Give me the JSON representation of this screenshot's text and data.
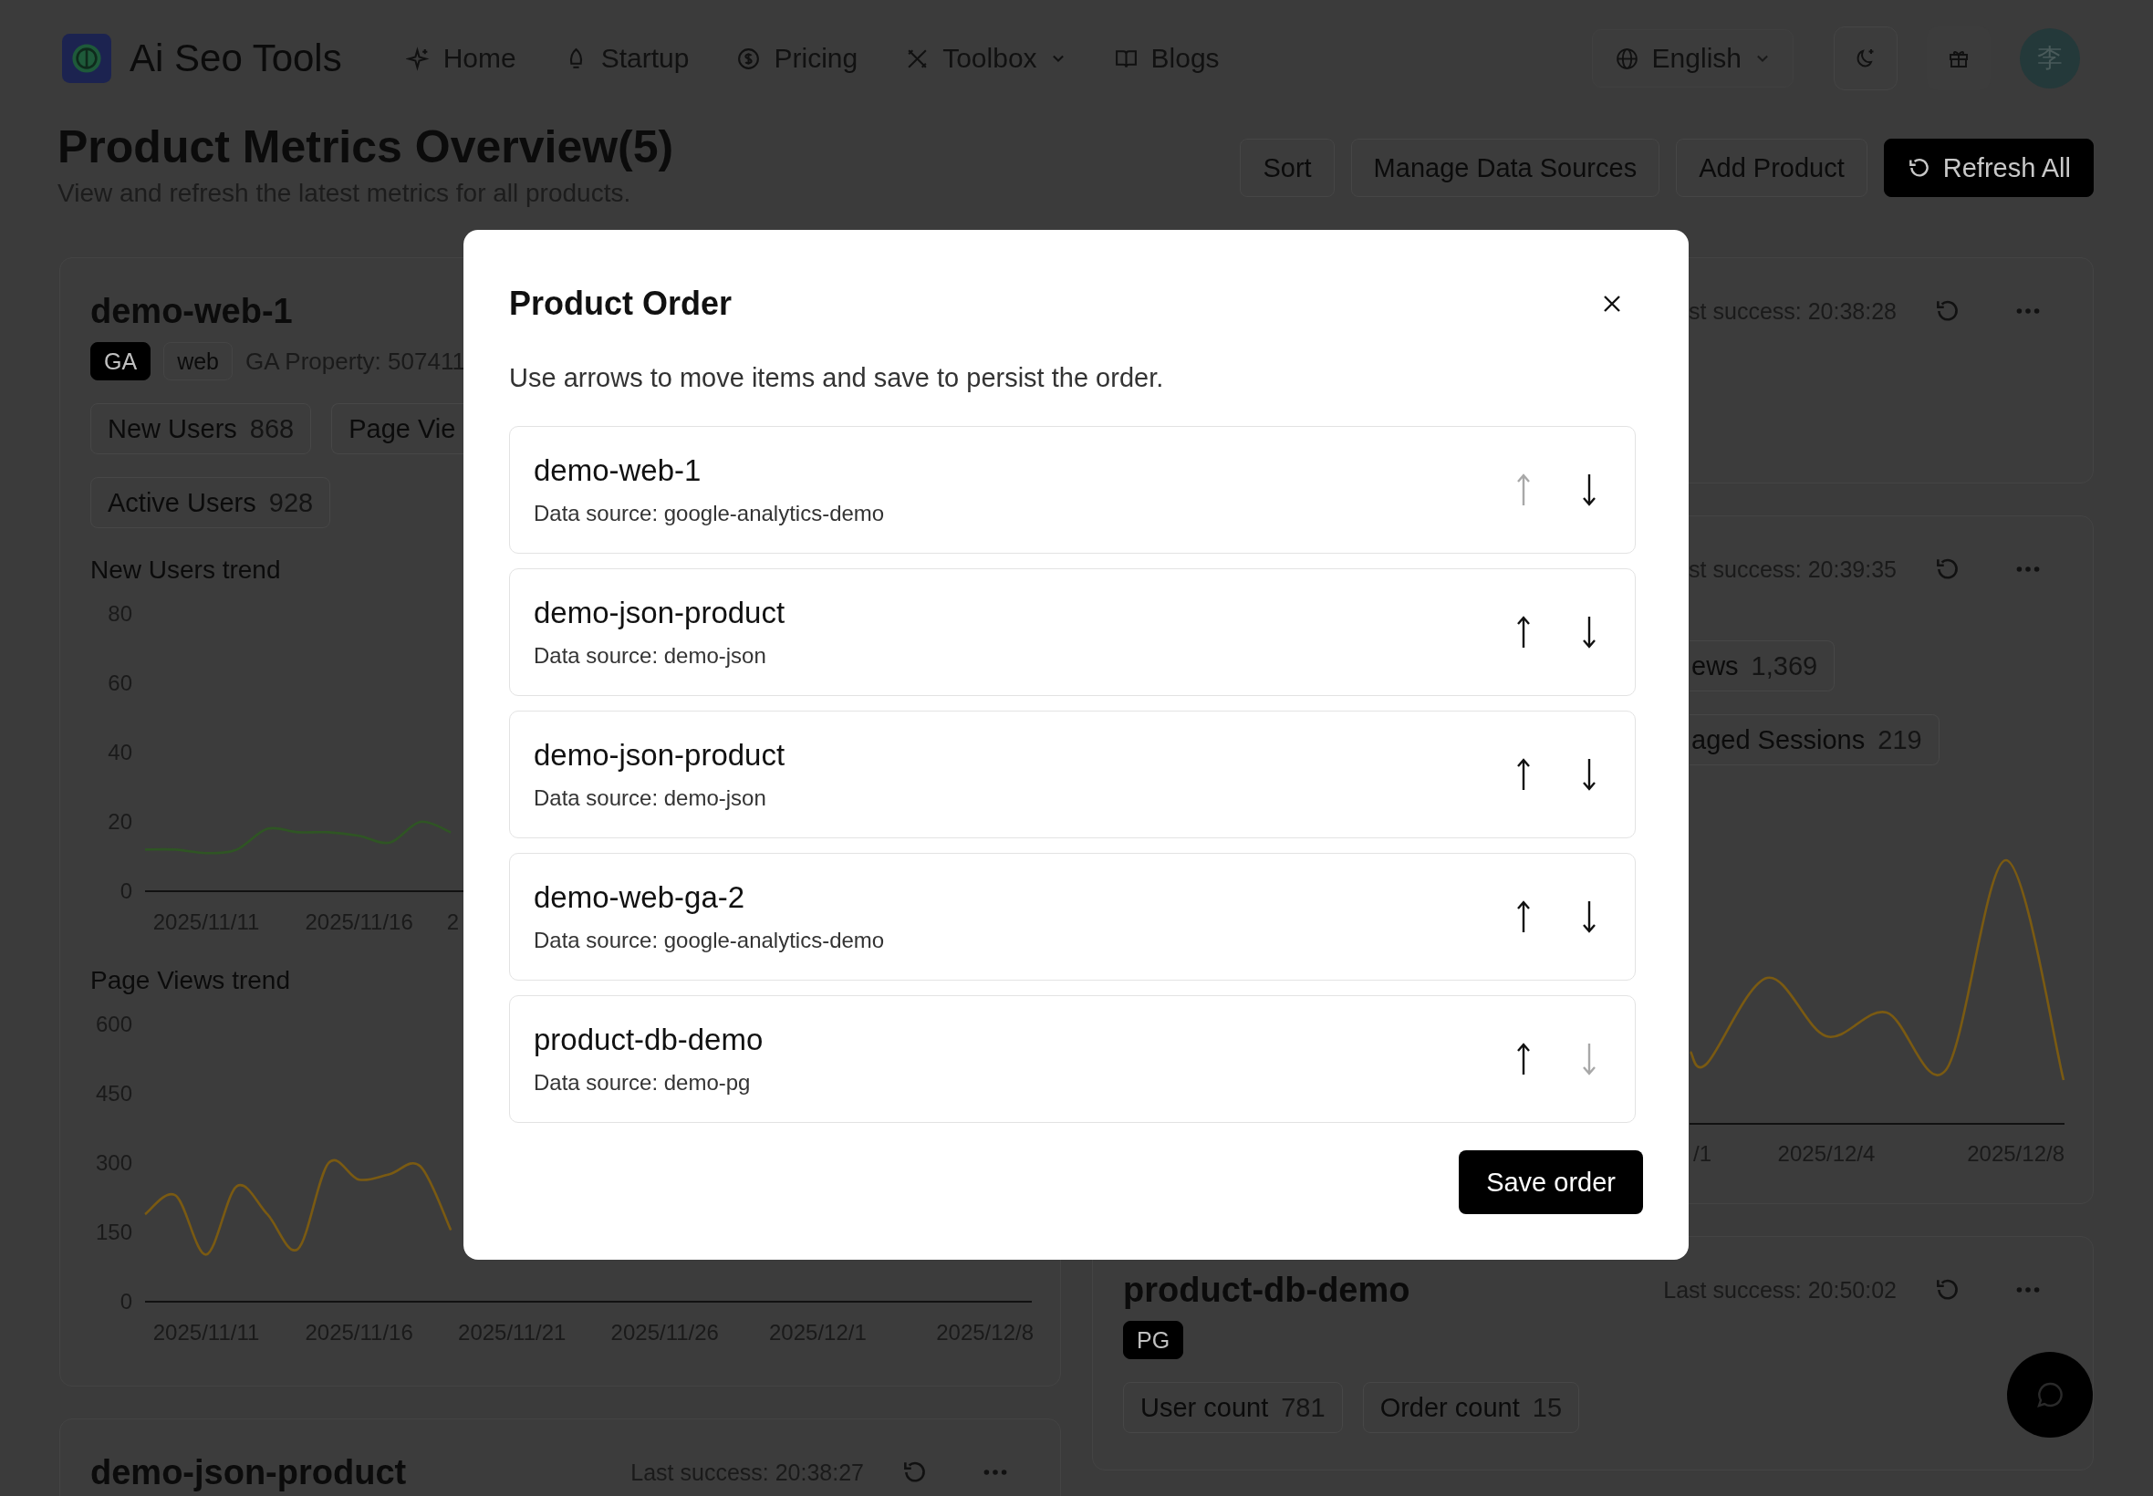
{
  "header": {
    "brand": "Ai Seo Tools",
    "nav": [
      {
        "label": "Home",
        "dropdown": false
      },
      {
        "label": "Startup",
        "dropdown": false
      },
      {
        "label": "Pricing",
        "dropdown": false
      },
      {
        "label": "Toolbox",
        "dropdown": true
      },
      {
        "label": "Blogs",
        "dropdown": false
      }
    ],
    "language": "English",
    "avatar": "李"
  },
  "page": {
    "title": "Product Metrics Overview(5)",
    "subtitle": "View and refresh the latest metrics for all products.",
    "actions": [
      {
        "label": "Sort",
        "primary": false
      },
      {
        "label": "Manage Data Sources",
        "primary": false
      },
      {
        "label": "Add Product",
        "primary": false
      },
      {
        "label": "Refresh All",
        "primary": true
      }
    ]
  },
  "left_column": [
    {
      "title": "demo-web-1",
      "badges": [
        {
          "label": "GA",
          "solid": true
        },
        {
          "label": "web",
          "solid": false
        }
      ],
      "property": "GA Property: 507411",
      "metrics": [
        [
          {
            "label": "New Users",
            "value": "868",
            "cut": false
          },
          {
            "label": "Page Vie",
            "cut": true
          }
        ],
        [
          {
            "label": "Active Users",
            "value": "928",
            "cut": false
          }
        ]
      ],
      "charts": [
        {
          "title": "New Users trend",
          "chart_data": {
            "type": "line",
            "categories": [
              null,
              null,
              "2025/11/11",
              null,
              null,
              null,
              null,
              "2025/11/16",
              null,
              null,
              null,
              null,
              null,
              null,
              null,
              null,
              null,
              null,
              null,
              null,
              null,
              null,
              null,
              null,
              null,
              null,
              null,
              null,
              null,
              null
            ],
            "series": [
              {
                "color": "#2f5524",
                "values": [
                  12,
                  12,
                  11,
                  12,
                  18,
                  17,
                  17,
                  16,
                  14,
                  20,
                  17,
                  null,
                  null,
                  null,
                  null,
                  null,
                  null,
                  null,
                  null,
                  null,
                  null,
                  null,
                  null,
                  null,
                  null,
                  null,
                  null,
                  null,
                  null,
                  null
                ]
              }
            ],
            "ylim": [
              0,
              80
            ],
            "yticks": [
              0,
              20,
              40,
              60,
              80
            ]
          },
          "partial_axis_label": "2"
        },
        {
          "title": "Page Views trend",
          "chart_data": {
            "type": "line",
            "categories": [
              null,
              null,
              "2025/11/11",
              null,
              null,
              null,
              null,
              "2025/11/16",
              null,
              null,
              null,
              null,
              "2025/11/21",
              null,
              null,
              null,
              null,
              "2025/11/26",
              null,
              null,
              null,
              null,
              "2025/12/1",
              null,
              null,
              null,
              null,
              null,
              null,
              "2025/12/8"
            ],
            "series": [
              {
                "color": "#7a5a12",
                "values": [
                  189,
                  230,
                  102,
                  250,
                  189,
                  114,
                  300,
                  264,
                  276,
                  293,
                  155,
                  null,
                  null,
                  null,
                  null,
                  null,
                  null,
                  null,
                  null,
                  null,
                  null,
                  null,
                  null,
                  null,
                  null,
                  null,
                  null,
                  null,
                  null,
                  null
                ]
              }
            ],
            "ylim": [
              0,
              600
            ],
            "yticks": [
              0,
              150,
              300,
              450,
              600
            ]
          }
        }
      ]
    },
    {
      "title": "demo-json-product",
      "last_success": "Last success: 20:38:27"
    }
  ],
  "right_column": [
    {
      "last_success": "st success: 20:38:28"
    },
    {
      "last_success": "st success: 20:39:35",
      "metrics": [
        [
          {
            "label": "ews",
            "value": "1,369",
            "cut": true
          }
        ],
        [
          {
            "label": "aged Sessions",
            "value": "219",
            "cut": true
          }
        ]
      ],
      "axis_labels": [
        "/1",
        "2025/12/4",
        "2025/12/8"
      ]
    },
    {
      "title": "product-db-demo",
      "last_success": "Last success: 20:50:02",
      "badges": [
        {
          "label": "PG",
          "solid": true
        }
      ],
      "metrics": [
        [
          {
            "label": "User count",
            "value": "781",
            "cut": false
          },
          {
            "label": "Order count",
            "value": "15",
            "cut": false
          }
        ]
      ]
    }
  ],
  "modal": {
    "title": "Product Order",
    "description": "Use arrows to move items and save to persist the order.",
    "items": [
      {
        "name": "demo-web-1",
        "source": "Data source: google-analytics-demo",
        "can_move_up": false,
        "can_move_down": true
      },
      {
        "name": "demo-json-product",
        "source": "Data source: demo-json",
        "can_move_up": true,
        "can_move_down": true
      },
      {
        "name": "demo-json-product",
        "source": "Data source: demo-json",
        "can_move_up": true,
        "can_move_down": true
      },
      {
        "name": "demo-web-ga-2",
        "source": "Data source: google-analytics-demo",
        "can_move_up": true,
        "can_move_down": true
      },
      {
        "name": "product-db-demo",
        "source": "Data source: demo-pg",
        "can_move_up": true,
        "can_move_down": false
      }
    ],
    "save_label": "Save order"
  }
}
